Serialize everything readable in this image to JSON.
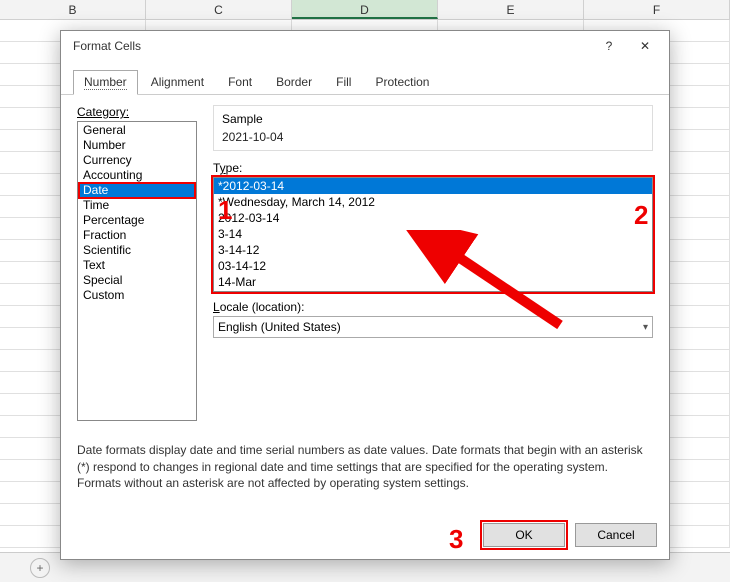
{
  "columns": [
    "B",
    "C",
    "D",
    "E",
    "F"
  ],
  "selected_col_index": 2,
  "dialog": {
    "title": "Format Cells",
    "help_icon": "?",
    "close_icon": "✕",
    "tabs": [
      "Number",
      "Alignment",
      "Font",
      "Border",
      "Fill",
      "Protection"
    ],
    "active_tab": 0,
    "category_label": "Category:",
    "categories": [
      "General",
      "Number",
      "Currency",
      "Accounting",
      "Date",
      "Time",
      "Percentage",
      "Fraction",
      "Scientific",
      "Text",
      "Special",
      "Custom"
    ],
    "selected_category": 4,
    "sample_label": "Sample",
    "sample_value": "2021-10-04",
    "type_label_pre": "T",
    "type_label_u": "y",
    "type_label_post": "pe:",
    "type_items": [
      "*2012-03-14",
      "*Wednesday, March 14, 2012",
      "2012-03-14",
      "3-14",
      "3-14-12",
      "03-14-12",
      "14-Mar"
    ],
    "selected_type": 0,
    "locale_label_u": "L",
    "locale_label_post": "ocale (location):",
    "locale_value": "English (United States)",
    "description": "Date formats display date and time serial numbers as date values.  Date formats that begin with an asterisk (*) respond to changes in regional date and time settings that are specified for the operating system. Formats without an asterisk are not affected by operating system settings.",
    "ok_label": "OK",
    "cancel_label": "Cancel"
  },
  "annotations": {
    "a1": "1",
    "a2": "2",
    "a3": "3"
  },
  "new_sheet_icon": "+"
}
